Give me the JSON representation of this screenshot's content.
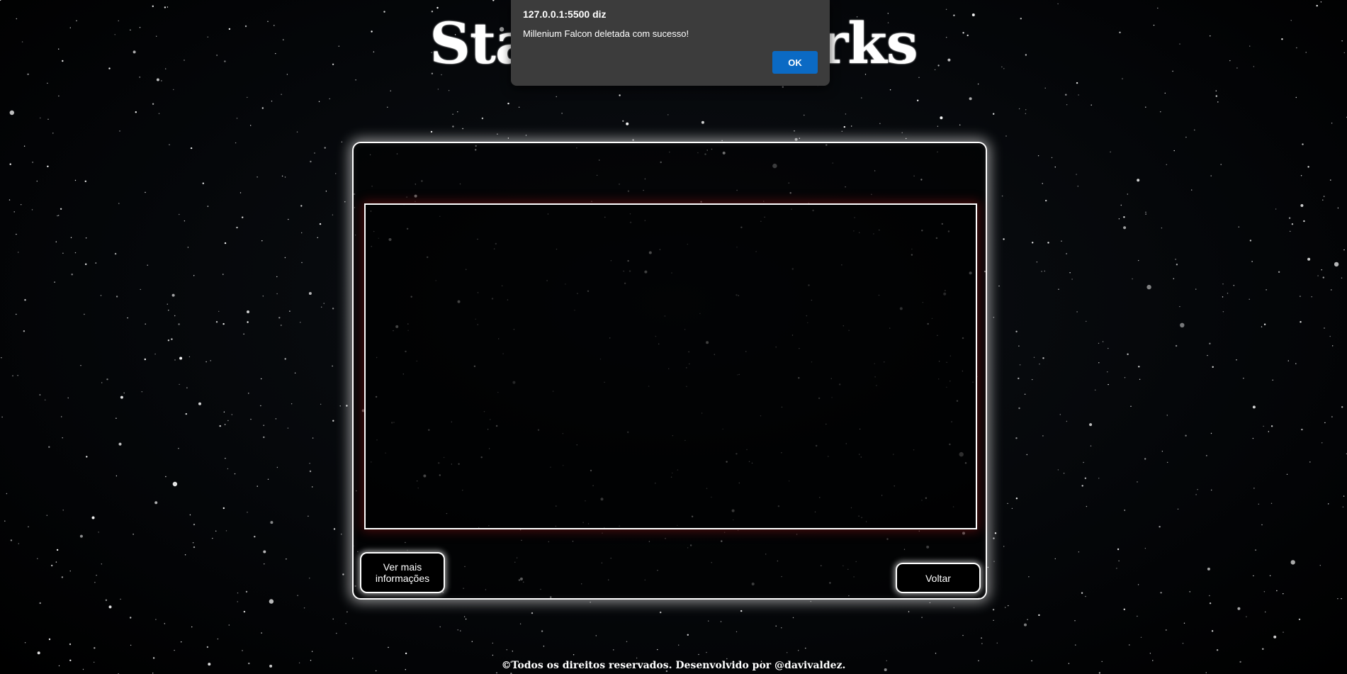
{
  "page": {
    "title": "Starships Parks",
    "footer": "©Todos os direitos reservados. Desenvolvido por @davivaldez."
  },
  "card": {
    "more_info_label": "Ver mais informações",
    "back_label": "Voltar"
  },
  "alert": {
    "origin": "127.0.0.1:5500 diz",
    "message": "Millenium Falcon deletada com sucesso!",
    "ok_label": "OK"
  },
  "colors": {
    "background": "#000000",
    "card_border": "#ffffff",
    "frame_glow": "#961414",
    "alert_background": "#3c3c3c",
    "alert_ok": "#0b6ac4"
  }
}
